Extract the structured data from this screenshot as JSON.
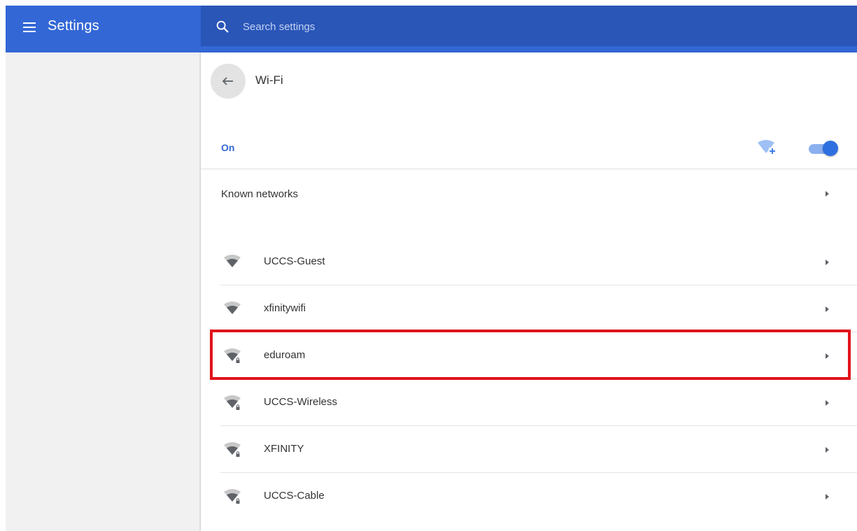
{
  "app": {
    "title": "Settings",
    "menu_icon": "hamburger-menu-icon"
  },
  "search": {
    "placeholder": "Search settings",
    "value": "",
    "icon": "search-icon"
  },
  "page": {
    "back_icon": "arrow-left-icon",
    "title": "Wi-Fi"
  },
  "wifi": {
    "status_label": "On",
    "enabled": true,
    "add_network_icon": "wifi-add-icon",
    "accent_color": "#3367d6"
  },
  "known_networks": {
    "label": "Known networks",
    "icon": "chevron-right-icon"
  },
  "networks": [
    {
      "name": "UCCS-Guest",
      "secured": false
    },
    {
      "name": "xfinitywifi",
      "secured": false
    },
    {
      "name": "eduroam",
      "secured": true,
      "highlighted": true
    },
    {
      "name": "UCCS-Wireless",
      "secured": true
    },
    {
      "name": "XFINITY",
      "secured": true
    },
    {
      "name": "UCCS-Cable",
      "secured": true
    }
  ],
  "colors": {
    "header": "#3367d6",
    "search_bar": "#2a56b8",
    "highlight_border": "#e0131b"
  }
}
